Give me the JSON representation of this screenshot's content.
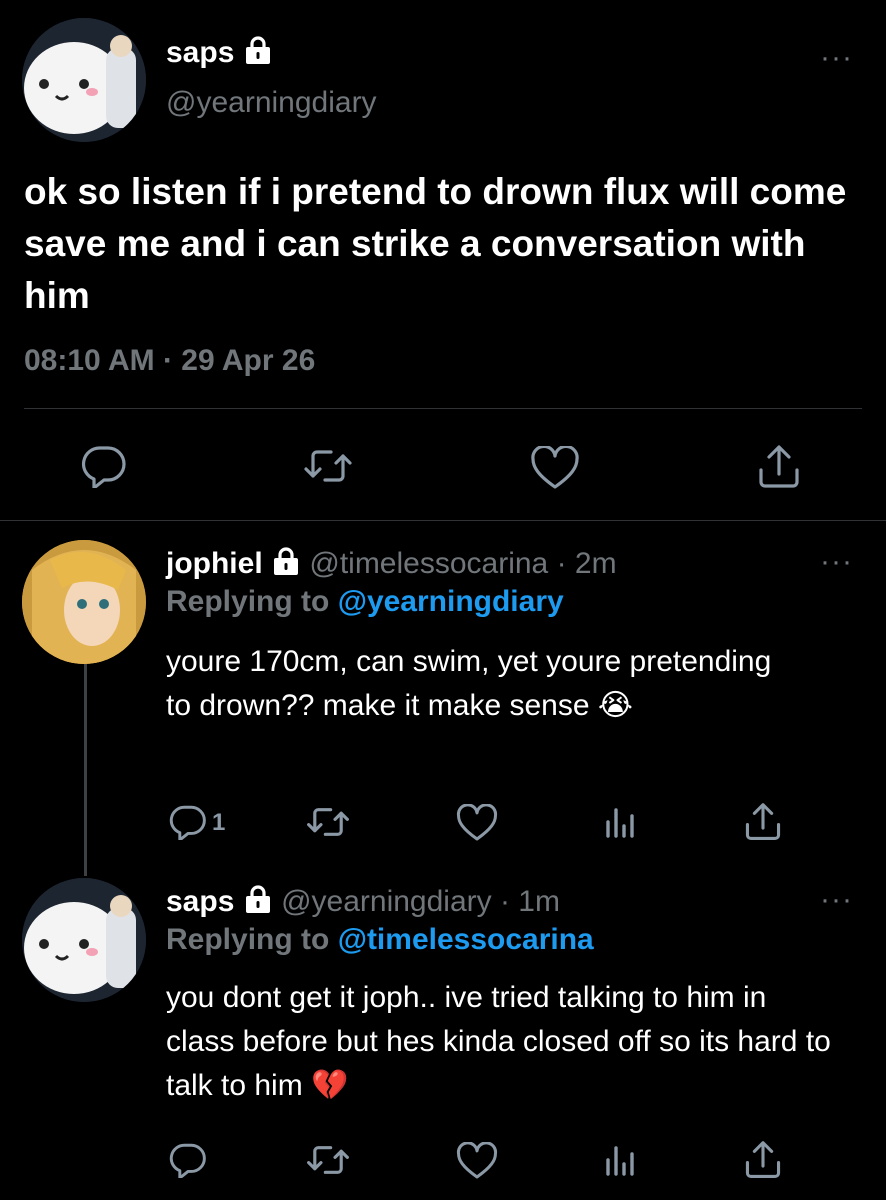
{
  "main_tweet": {
    "name": "saps",
    "handle": "@yearningdiary",
    "text": "ok so listen if i pretend to drown flux will come save me and i can strike a conversation with him",
    "time": "08:10 AM",
    "sep": "·",
    "date": "29 Apr 26"
  },
  "replies": [
    {
      "name": "jophiel",
      "handle": "@timelessocarina",
      "ago": "· 2m",
      "replying_label": "Replying to",
      "replying_to": "@yearningdiary",
      "text": "youre 170cm, can swim, yet youre pretending to drown?? make it make sense",
      "emoji": "😭",
      "reply_count": "1"
    },
    {
      "name": "saps",
      "handle": "@yearningdiary",
      "ago": "· 1m",
      "replying_label": "Replying to",
      "replying_to": "@timelessocarina",
      "text": "you dont get it joph.. ive tried talking to him in class before but hes kinda closed off so its hard to talk to him",
      "emoji": "💔"
    }
  ],
  "more_glyph": "···",
  "colors": {
    "background": "#000000",
    "text": "#ffffff",
    "muted": "#71767b",
    "link": "#1d9bf0",
    "divider": "#2f3336"
  },
  "icons": [
    "lock-icon",
    "reply-icon",
    "retweet-icon",
    "like-icon",
    "share-icon",
    "analytics-icon",
    "more-icon"
  ]
}
